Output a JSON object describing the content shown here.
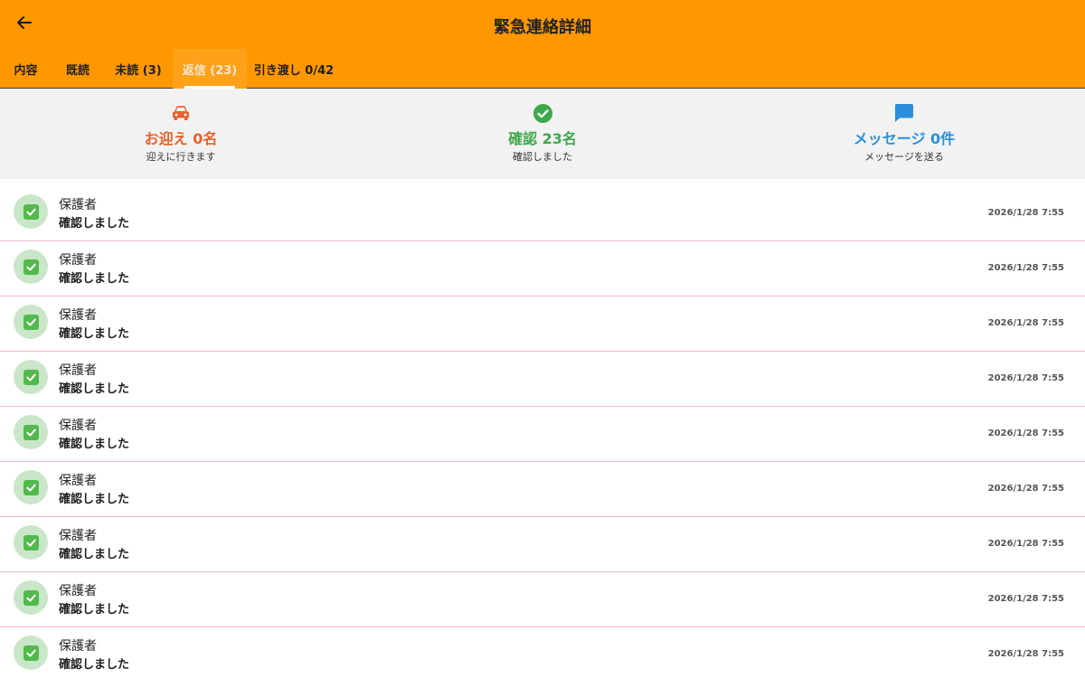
{
  "header": {
    "title": "緊急連絡詳細",
    "back_icon": "arrow-left-icon"
  },
  "tabs": [
    {
      "label": "内容",
      "active": false
    },
    {
      "label": "既読",
      "active": false
    },
    {
      "label": "未読 (3)",
      "active": false
    },
    {
      "label": "返信 (23)",
      "active": true
    },
    {
      "label": "引き渡し 0/42",
      "active": false
    }
  ],
  "summary": {
    "pickup": {
      "icon": "car-icon",
      "title": "お迎え 0名",
      "subtitle": "迎えに行きます",
      "color": "#E8612C"
    },
    "confirm": {
      "icon": "check-circle-icon",
      "title": "確認 23名",
      "subtitle": "確認しました",
      "color": "#3FA84B"
    },
    "message": {
      "icon": "chat-bubble-icon",
      "title": "メッセージ 0件",
      "subtitle": "メッセージを送る",
      "color": "#2B8FDB"
    }
  },
  "replies": [
    {
      "name": "保護者",
      "status": "確認しました",
      "time": "2026/1/28 7:55"
    },
    {
      "name": "保護者",
      "status": "確認しました",
      "time": "2026/1/28 7:55"
    },
    {
      "name": "保護者",
      "status": "確認しました",
      "time": "2026/1/28 7:55"
    },
    {
      "name": "保護者",
      "status": "確認しました",
      "time": "2026/1/28 7:55"
    },
    {
      "name": "保護者",
      "status": "確認しました",
      "time": "2026/1/28 7:55"
    },
    {
      "name": "保護者",
      "status": "確認しました",
      "time": "2026/1/28 7:55"
    },
    {
      "name": "保護者",
      "status": "確認しました",
      "time": "2026/1/28 7:55"
    },
    {
      "name": "保護者",
      "status": "確認しました",
      "time": "2026/1/28 7:55"
    },
    {
      "name": "保護者",
      "status": "確認しました",
      "time": "2026/1/28 7:55"
    }
  ],
  "colors": {
    "header_bg": "#FF9800",
    "active_tab_bg": "#FFA21A",
    "summary_bg": "#f2f2f2",
    "row_divider": "#F4B6C2",
    "avatar_bg": "#C9E6C9",
    "check_green": "#52B94C"
  }
}
